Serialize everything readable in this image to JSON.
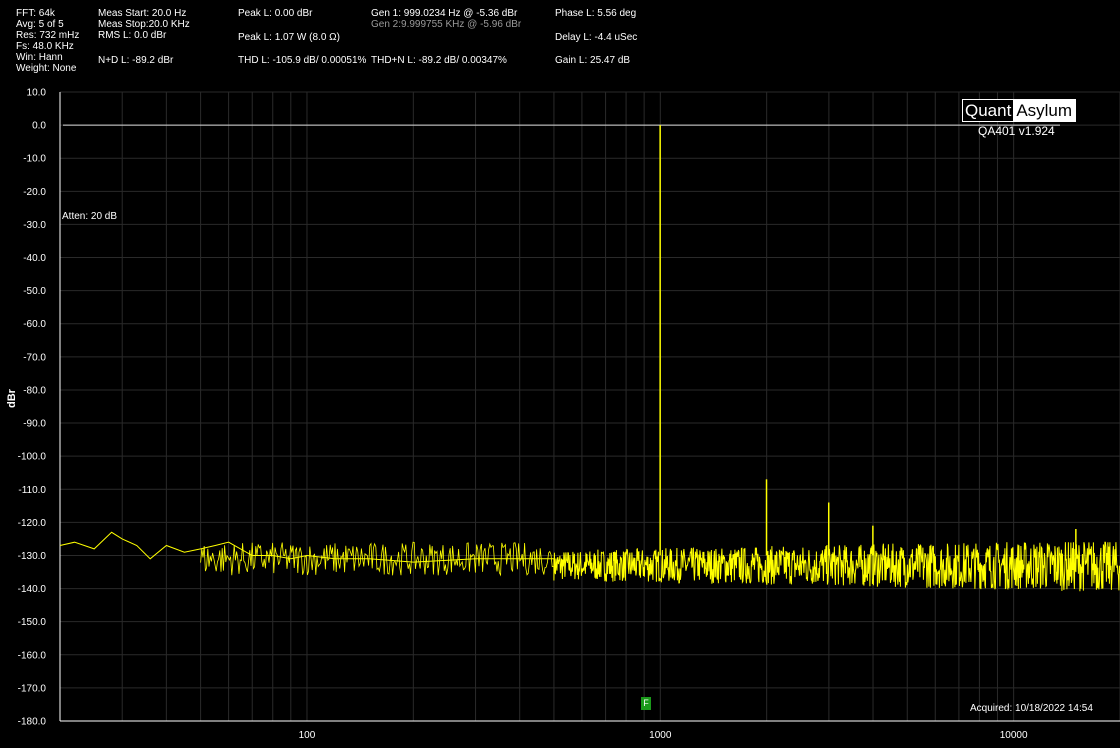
{
  "header": {
    "col1": [
      "FFT: 64k",
      "Avg: 5 of 5",
      "Res: 732 mHz",
      "Fs: 48.0 KHz",
      "Win: Hann",
      "Weight: None"
    ],
    "meas_start": "Meas Start: 20.0 Hz",
    "meas_stop": "Meas Stop:20.0 KHz",
    "rms": "RMS L: 0.0 dBr",
    "n_d": "N+D L: -89.2 dBr",
    "peak_l": "Peak L: 0.00 dBr",
    "peak_w": "Peak L: 1.07 W (8.0 Ω)",
    "thd": "THD L: -105.9 dB/ 0.00051%",
    "gen1": "Gen 1: 999.0234 Hz @ -5.36  dBr",
    "gen2": "Gen 2:9.999755 KHz @ -5.96  dBr",
    "thdn": "THD+N L: -89.2 dB/ 0.00347%",
    "phase": "Phase L: 5.56 deg",
    "delay": "Delay L: -4.4 uSec",
    "gain": "Gain L: 25.47 dB"
  },
  "logo": {
    "quant": "Quant",
    "asylum": "Asylum",
    "version": "QA401 v1.924"
  },
  "atten": "Atten: 20 dB",
  "acquired": "Acquired: 10/18/2022  14:54",
  "marker": "F",
  "colors": {
    "trace": "#ffff00",
    "grid": "#2a2a2a",
    "axis": "#ffffff",
    "background": "#000000"
  },
  "chart_data": {
    "type": "line",
    "xlabel": "",
    "ylabel": "dBr",
    "x_scale": "log",
    "xlim": [
      20,
      20000
    ],
    "ylim": [
      -180,
      10
    ],
    "x_ticks": [
      100,
      1000,
      10000
    ],
    "y_ticks": [
      10,
      0,
      -10,
      -20,
      -30,
      -40,
      -50,
      -60,
      -70,
      -80,
      -90,
      -100,
      -110,
      -120,
      -130,
      -140,
      -150,
      -160,
      -170,
      -180
    ],
    "y_tick_format": "0.0",
    "grid": true,
    "reference_line_dbr": 0,
    "series": [
      {
        "x": [
          20,
          22,
          25,
          28,
          30,
          33,
          36,
          40,
          45,
          50,
          55,
          60,
          70,
          80,
          90,
          100,
          120,
          150,
          200,
          300,
          500,
          700,
          900,
          999,
          1100,
          1500,
          1998,
          2500,
          2997,
          3500,
          3996,
          5000,
          6000,
          8000,
          10000,
          12000,
          14000,
          15000,
          17000,
          20000
        ],
        "y": [
          -127,
          -126,
          -128,
          -123,
          -125,
          -127,
          -131,
          -127,
          -129,
          -128,
          -127,
          -126,
          -130,
          -130,
          -131,
          -130,
          -131,
          -131,
          -132,
          -131,
          -131,
          -131,
          -131,
          0,
          -131,
          -131,
          -107,
          -131,
          -114,
          -131,
          -121,
          -131,
          -131,
          -131,
          -131,
          -131,
          -131,
          -122,
          -131,
          -131
        ]
      }
    ],
    "noise_band": {
      "x_from": 500,
      "x_to": 20000,
      "low": -140,
      "high": -126
    },
    "harmonic_peaks": [
      {
        "x": 999,
        "y": 0
      },
      {
        "x": 1998,
        "y": -107
      },
      {
        "x": 2997,
        "y": -114
      },
      {
        "x": 3996,
        "y": -121
      },
      {
        "x": 15000,
        "y": -122
      }
    ]
  }
}
